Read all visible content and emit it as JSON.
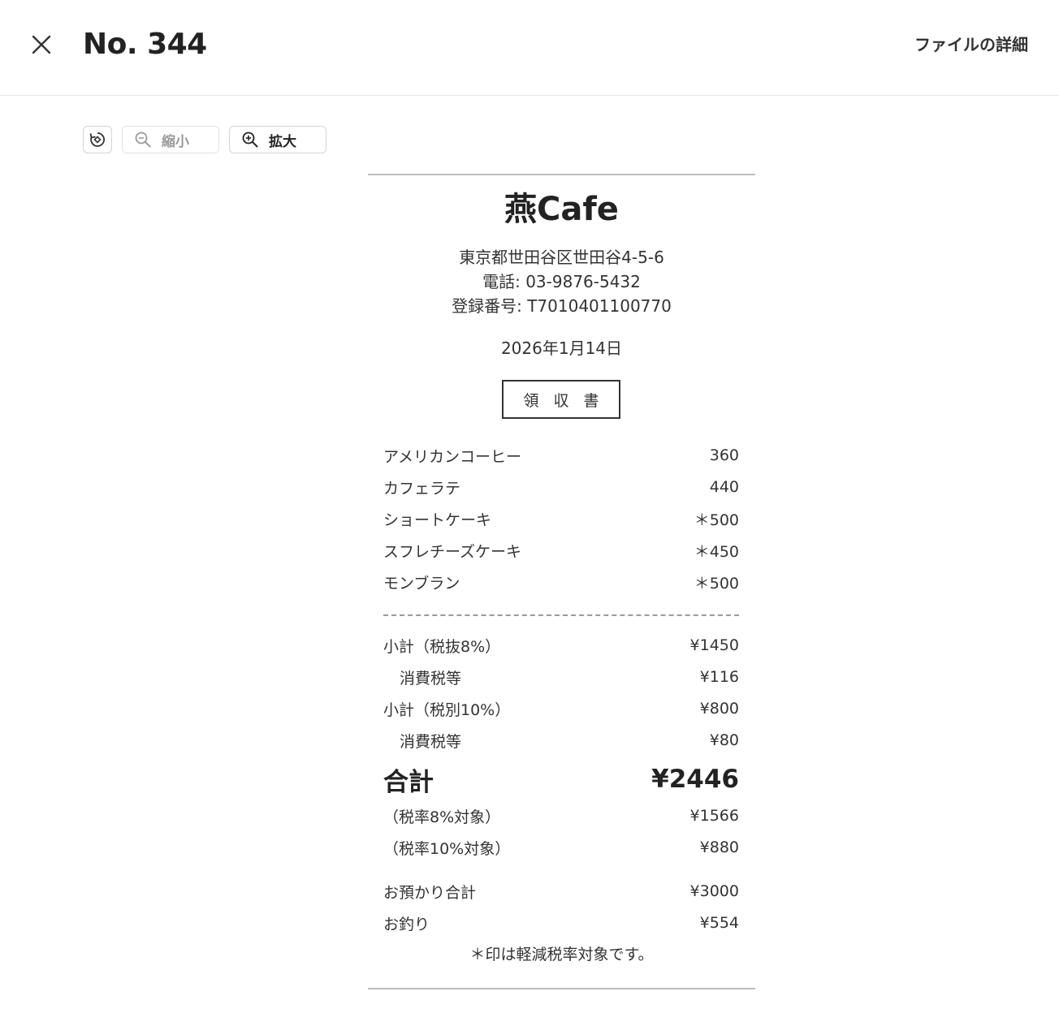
{
  "header": {
    "title": "No. 344",
    "file_detail": "ファイルの詳細"
  },
  "toolbar": {
    "zoom_out": "縮小",
    "zoom_in": "拡大"
  },
  "receipt": {
    "store_name": "燕Cafe",
    "address": "東京都世田谷区世田谷4-5-6",
    "phone": "電話: 03-9876-5432",
    "registration": "登録番号: T7010401100770",
    "date": "2026年1月14日",
    "doc_type": "領収書",
    "items": [
      {
        "name": "アメリカンコーヒー",
        "price": "360"
      },
      {
        "name": "カフェラテ",
        "price": "440"
      },
      {
        "name": "ショートケーキ",
        "price": "＊500"
      },
      {
        "name": "スフレチーズケーキ",
        "price": "＊450"
      },
      {
        "name": "モンブラン",
        "price": "＊500"
      }
    ],
    "subtotals": [
      {
        "label": "小計（税抜8%）",
        "value": "¥1450"
      },
      {
        "label": "消費税等",
        "value": "¥116"
      },
      {
        "label": "小計（税別10%）",
        "value": "¥800"
      },
      {
        "label": "消費税等",
        "value": "¥80"
      }
    ],
    "total_label": "合計",
    "total_value": "¥2446",
    "breakdown": [
      {
        "label": "（税率8%対象）",
        "value": "¥1566"
      },
      {
        "label": "（税率10%対象）",
        "value": "¥880"
      }
    ],
    "payment": [
      {
        "label": "お預かり合計",
        "value": "¥3000"
      },
      {
        "label": "お釣り",
        "value": "¥554"
      }
    ],
    "note": "＊印は軽減税率対象です。"
  }
}
